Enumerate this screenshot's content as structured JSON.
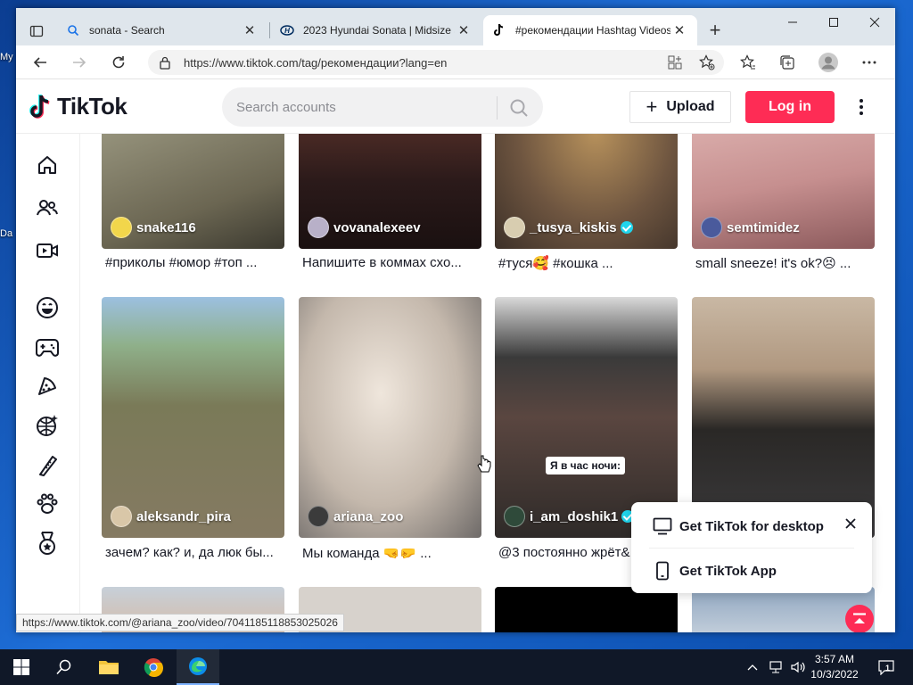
{
  "browser": {
    "tabs": [
      {
        "title": "sonata - Search",
        "favicon": "search-icon",
        "active": false
      },
      {
        "title": "2023 Hyundai Sonata | Midsize S",
        "favicon": "hyundai-logo",
        "active": false
      },
      {
        "title": "#рекомендации Hashtag Videos",
        "favicon": "tiktok-logo",
        "active": true
      }
    ],
    "url": "https://www.tiktok.com/tag/рекомендации?lang=en",
    "status_url": "https://www.tiktok.com/@ariana_zoo/video/7041185118853025026"
  },
  "tiktok": {
    "logo_text": "TikTok",
    "search_placeholder": "Search accounts",
    "upload_label": "Upload",
    "login_label": "Log in",
    "nav": [
      "home-icon",
      "following-icon",
      "live-icon",
      "comedy-icon",
      "gaming-icon",
      "food-icon",
      "sports-icon",
      "beauty-icon",
      "animals-icon",
      "medal-icon"
    ],
    "videos": [
      {
        "user": "snake116",
        "desc": "#приколы #юмор #топ ...",
        "verified": false,
        "bg": "#8c8a78"
      },
      {
        "user": "vovanalexeev",
        "desc": "Напишите в коммах схо...",
        "verified": false,
        "bg": "#3a2a2a"
      },
      {
        "user": "_tusya_kiskis",
        "desc": "#туся🥰 #кошка ...",
        "verified": true,
        "bg": "#6b5a48"
      },
      {
        "user": "semtimidez",
        "desc": "small sneeze! it's ok?😣 ...",
        "verified": false,
        "bg": "#c9a6a0"
      },
      {
        "user": "aleksandr_pira",
        "desc": "зачем? как? и, да люк бы...",
        "verified": false,
        "bg": "#7a7a5a"
      },
      {
        "user": "ariana_zoo",
        "desc": "Мы команда 🤜🤛 ...",
        "verified": false,
        "bg": "#bfb7b0"
      },
      {
        "user": "i_am_doshik1",
        "desc": "@3 постоянно жрёт&",
        "verified": true,
        "bg": "#4a4442",
        "overlay": "Я в час ночи:"
      },
      {
        "user": "",
        "desc": "",
        "verified": false,
        "bg": "#b7a490"
      }
    ],
    "popup": {
      "desktop_label": "Get TikTok for desktop",
      "app_label": "Get TikTok App"
    }
  },
  "taskbar": {
    "time": "3:57 AM",
    "date": "10/3/2022",
    "notifications": "1"
  },
  "desktop_icons": [
    "My",
    "Da"
  ]
}
